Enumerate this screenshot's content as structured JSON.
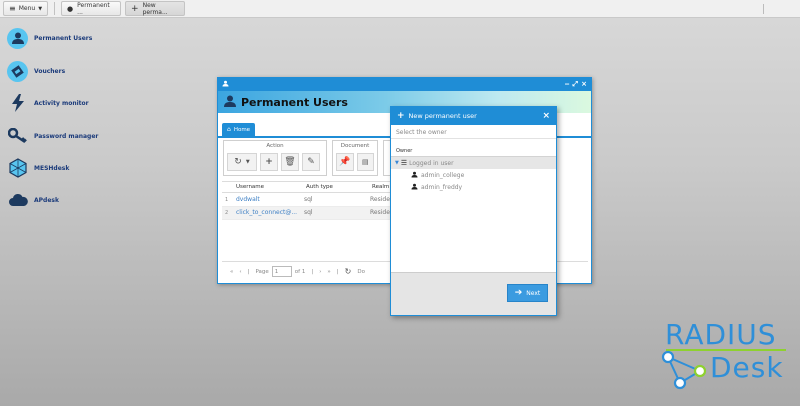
{
  "taskbar": {
    "menu_label": "Menu",
    "tasks": [
      {
        "label": "Permanent ..."
      },
      {
        "label": "New perma..."
      }
    ]
  },
  "desktop": {
    "items": [
      {
        "label": "Permanent Users",
        "icon": "user-icon"
      },
      {
        "label": "Vouchers",
        "icon": "voucher-icon"
      },
      {
        "label": "Activity monitor",
        "icon": "lightning-icon"
      },
      {
        "label": "Password manager",
        "icon": "key-icon"
      },
      {
        "label": "MESHdesk",
        "icon": "mesh-icon"
      },
      {
        "label": "APdesk",
        "icon": "cloud-icon"
      }
    ]
  },
  "window": {
    "title": "Permanent Users",
    "tab_label": "Home",
    "toolbar": {
      "action_label": "Action",
      "document_label": "Document"
    },
    "grid": {
      "columns": [
        "Username",
        "Auth type",
        "Realm"
      ],
      "rows": [
        {
          "num": "1",
          "username": "dvdwalt",
          "auth": "sql",
          "realm": "Residen"
        },
        {
          "num": "2",
          "username": "click_to_connect@...",
          "auth": "sql",
          "realm": "Residen"
        }
      ]
    },
    "pager": {
      "page_label": "Page",
      "page_value": "1",
      "of_label": "of 1",
      "trailing": "Do"
    }
  },
  "dialog": {
    "title": "New permanent user",
    "subtitle": "Select the owner",
    "column_label": "Owner",
    "tree": {
      "root": "Logged in user",
      "children": [
        "admin_college",
        "admin_freddy"
      ]
    },
    "next_label": "Next"
  },
  "logo": {
    "line1": "RADIUS",
    "line2": "Desk"
  },
  "colors": {
    "accent": "#1f8dd6",
    "desk_icon": "#58c5f0",
    "logo_blue": "#2f8fd8",
    "logo_green": "#8ed12f"
  }
}
